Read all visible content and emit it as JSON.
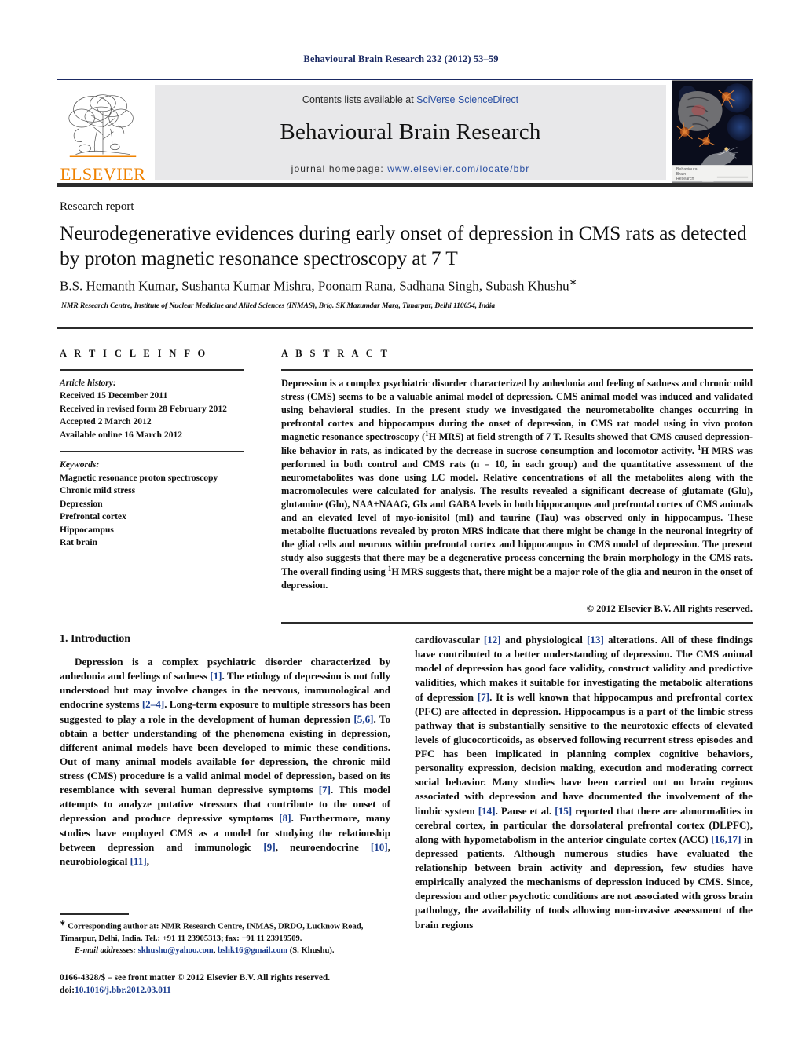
{
  "running_head": "Behavioural Brain Research 232 (2012) 53–59",
  "masthead": {
    "publisher_name": "ELSEVIER",
    "contents_prefix": "Contents lists available at ",
    "contents_link": "SciVerse ScienceDirect",
    "journal_title": "Behavioural Brain Research",
    "homepage_prefix": "journal homepage: ",
    "homepage_url": "www.elsevier.com/locate/bbr",
    "cover_caption_line1": "Behavioural",
    "cover_caption_line2": "Brain",
    "cover_caption_line3": "Research",
    "link_color": "#2a4fa2",
    "band_color": "#e8e8ea",
    "elsevier_orange": "#ef8200"
  },
  "article": {
    "type_label": "Research report",
    "title": "Neurodegenerative evidences during early onset of depression in CMS rats as detected by proton magnetic resonance spectroscopy at 7 T",
    "authors": "B.S. Hemanth Kumar, Sushanta Kumar Mishra, Poonam Rana, Sadhana Singh, Subash Khushu",
    "corresponding_marker": "∗",
    "affiliation": "NMR Research Centre, Institute of Nuclear Medicine and Allied Sciences (INMAS), Brig. SK Mazumdar Marg, Timarpur, Delhi 110054, India"
  },
  "article_info": {
    "heading": "A R T I C L E   I N F O",
    "history_label": "Article history:",
    "history": [
      "Received 15 December 2011",
      "Received in revised form 28 February 2012",
      "Accepted 2 March 2012",
      "Available online 16 March 2012"
    ],
    "keywords_label": "Keywords:",
    "keywords": [
      "Magnetic resonance proton spectroscopy",
      "Chronic mild stress",
      "Depression",
      "Prefrontal cortex",
      "Hippocampus",
      "Rat brain"
    ]
  },
  "abstract": {
    "heading": "A B S T R A C T",
    "text_part1": "Depression is a complex psychiatric disorder characterized by anhedonia and feeling of sadness and chronic mild stress (CMS) seems to be a valuable animal model of depression. CMS animal model was induced and validated using behavioral studies. In the present study we investigated the neurometabolite changes occurring in prefrontal cortex and hippocampus during the onset of depression, in CMS rat model using in vivo proton magnetic resonance spectroscopy (",
    "sup1": "1",
    "text_part2": "H MRS) at field strength of 7 T. Results showed that CMS caused depression-like behavior in rats, as indicated by the decrease in sucrose consumption and locomotor activity. ",
    "sup2": "1",
    "text_part3": "H MRS was performed in both control and CMS rats (n = 10, in each group) and the quantitative assessment of the neurometabolites was done using LC model. Relative concentrations of all the metabolites along with the macromolecules were calculated for analysis. The results revealed a significant decrease of glutamate (Glu), glutamine (Gln), NAA+NAAG, Glx and GABA levels in both hippocampus and prefrontal cortex of CMS animals and an elevated level of myo-ionisitol (mI) and taurine (Tau) was observed only in hippocampus. These metabolite fluctuations revealed by proton MRS indicate that there might be change in the neuronal integrity of the glial cells and neurons within prefrontal cortex and hippocampus in CMS model of depression. The present study also suggests that there may be a degenerative process concerning the brain morphology in the CMS rats. The overall finding using ",
    "sup3": "1",
    "text_part4": "H MRS suggests that, there might be a major role of the glia and neuron in the onset of depression.",
    "copyright": "© 2012 Elsevier B.V. All rights reserved."
  },
  "body": {
    "section_number_title": "1. Introduction",
    "left_column": {
      "para1_a": "Depression is a complex psychiatric disorder characterized by anhedonia and feelings of sadness ",
      "ref1": "[1]",
      "para1_b": ". The etiology of depression is not fully understood but may involve changes in the nervous, immunological and endocrine systems ",
      "ref2": "[2–4]",
      "para1_c": ". Long-term exposure to multiple stressors has been suggested to play a role in the development of human depression ",
      "ref3": "[5,6]",
      "para1_d": ". To obtain a better understanding of the phenomena existing in depression, different animal models have been developed to mimic these conditions. Out of many animal models available for depression, the chronic mild stress (CMS) procedure is a valid animal model of depression, based on its resemblance with several human depressive symptoms ",
      "ref4": "[7]",
      "para1_e": ". This model attempts to analyze putative stressors that contribute to the onset of depression and produce depressive symptoms ",
      "ref5": "[8]",
      "para1_f": ". Furthermore, many studies have employed CMS as a model for studying the relationship between depression and immunologic ",
      "ref6": "[9]",
      "para1_g": ", neuroendocrine ",
      "ref7": "[10]",
      "para1_h": ", neurobiological ",
      "ref8": "[11]",
      "para1_i": ","
    },
    "right_column": {
      "cont_a": "cardiovascular ",
      "ref9": "[12]",
      "cont_b": " and physiological ",
      "ref10": "[13]",
      "cont_c": " alterations. All of these findings have contributed to a better understanding of depression. The CMS animal model of depression has good face validity, construct validity and predictive validities, which makes it suitable for investigating the metabolic alterations of depression ",
      "ref11": "[7]",
      "cont_d": ". It is well known that hippocampus and prefrontal cortex (PFC) are affected in depression. Hippocampus is a part of the limbic stress pathway that is substantially sensitive to the neurotoxic effects of elevated levels of glucocorticoids, as observed following recurrent stress episodes and PFC has been implicated in planning complex cognitive behaviors, personality expression, decision making, execution and moderating correct social behavior. Many studies have been carried out on brain regions associated with depression and have documented the involvement of the limbic system ",
      "ref12": "[14]",
      "cont_e": ". Pause et al. ",
      "ref13": "[15]",
      "cont_f": " reported that there are abnormalities in cerebral cortex, in particular the dorsolateral prefrontal cortex (DLPFC), along with hypometabolism in the anterior cingulate cortex (ACC) ",
      "ref14": "[16,17]",
      "cont_g": " in depressed patients. Although numerous studies have evaluated the relationship between brain activity and depression, few studies have empirically analyzed the mechanisms of depression induced by CMS. Since, depression and other psychotic conditions are not associated with gross brain pathology, the availability of tools allowing non-invasive assessment of the brain regions"
    }
  },
  "footnotes": {
    "corresponding_marker": "∗",
    "corresponding_text": " Corresponding author at: NMR Research Centre, INMAS, DRDO, Lucknow Road, Timarpur, Delhi, India. Tel.: +91 11 23905313; fax: +91 11 23919509.",
    "email_label": "E-mail addresses:",
    "email1": "skhushu@yahoo.com",
    "email_sep": ", ",
    "email2": "bshk16@gmail.com",
    "email_owner": " (S. Khushu).",
    "issn_line": "0166-4328/$ – see front matter © 2012 Elsevier B.V. All rights reserved.",
    "doi_prefix": "doi:",
    "doi_value": "10.1016/j.bbr.2012.03.011"
  }
}
